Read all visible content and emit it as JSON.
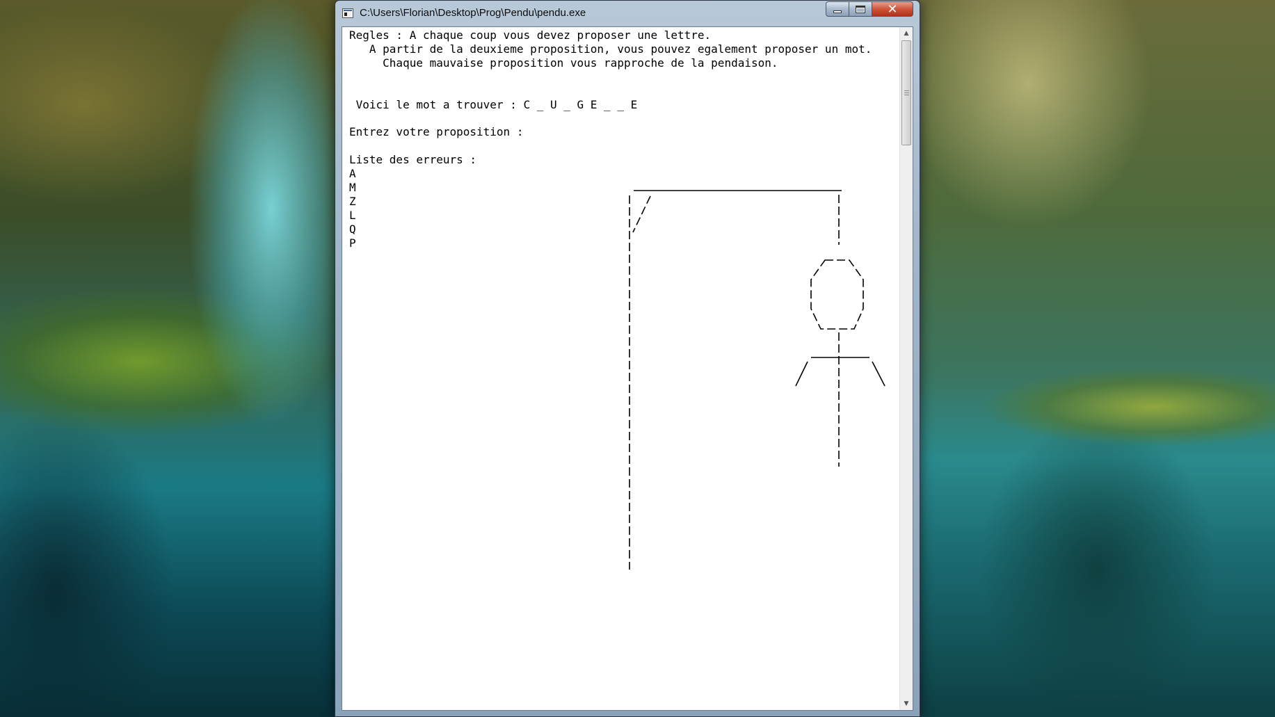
{
  "window": {
    "title": "C:\\Users\\Florian\\Desktop\\Prog\\Pendu\\pendu.exe",
    "close_symbol": "✕"
  },
  "console": {
    "rules_line1": "Regles : A chaque coup vous devez proposer une lettre.",
    "rules_line2": "   A partir de la deuxieme proposition, vous pouvez egalement proposer un mot.",
    "rules_line3": "     Chaque mauvaise proposition vous rapproche de la pendaison.",
    "word_prompt": " Voici le mot a trouver : ",
    "word_pattern": "C _ U _ G E _ _ E",
    "input_prompt": "Entrez votre proposition : ",
    "errors_heading": "Liste des erreurs :",
    "errors": [
      "A",
      "M",
      "Z",
      "L",
      "Q",
      "P"
    ]
  },
  "icons": {
    "app": "console-app-icon",
    "minimize": "minimize-icon",
    "maximize": "maximize-icon",
    "close": "close-icon",
    "scroll_up": "scroll-up-arrow-icon",
    "scroll_down": "scroll-down-arrow-icon"
  },
  "colors": {
    "console_background": "#ffffff",
    "console_text": "#000000",
    "close_button": "#c7472c"
  }
}
